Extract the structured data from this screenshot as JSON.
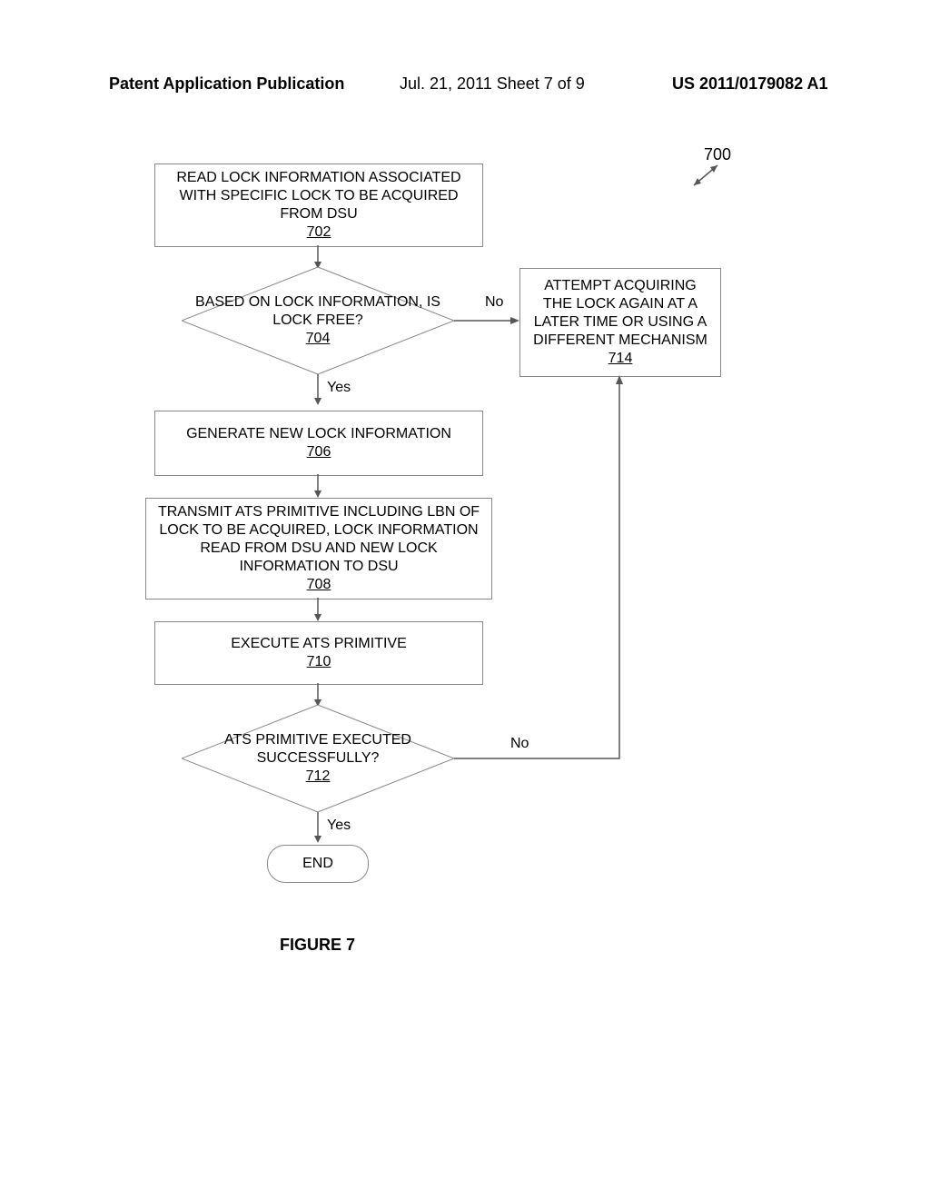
{
  "header": {
    "left": "Patent Application Publication",
    "mid": "Jul. 21, 2011  Sheet 7 of 9",
    "right": "US 2011/0179082 A1"
  },
  "ref": "700",
  "box702": {
    "text": "READ LOCK INFORMATION ASSOCIATED WITH SPECIFIC LOCK TO BE ACQUIRED FROM DSU",
    "num": "702"
  },
  "dec704": {
    "text": "BASED ON LOCK INFORMATION, IS LOCK FREE?",
    "num": "704",
    "yes": "Yes",
    "no": "No"
  },
  "box706": {
    "text": "GENERATE NEW LOCK INFORMATION",
    "num": "706"
  },
  "box708": {
    "text": "TRANSMIT ATS PRIMITIVE INCLUDING LBN OF LOCK TO BE ACQUIRED, LOCK INFORMATION READ FROM DSU AND NEW LOCK INFORMATION TO DSU",
    "num": "708"
  },
  "box710": {
    "text": "EXECUTE ATS PRIMITIVE",
    "num": "710"
  },
  "dec712": {
    "text": "ATS PRIMITIVE EXECUTED SUCCESSFULLY?",
    "num": "712",
    "yes": "Yes",
    "no": "No"
  },
  "box714": {
    "text": "ATTEMPT ACQUIRING THE LOCK AGAIN AT A LATER TIME OR USING A DIFFERENT MECHANISM",
    "num": "714"
  },
  "end": "END",
  "figure": "FIGURE 7"
}
